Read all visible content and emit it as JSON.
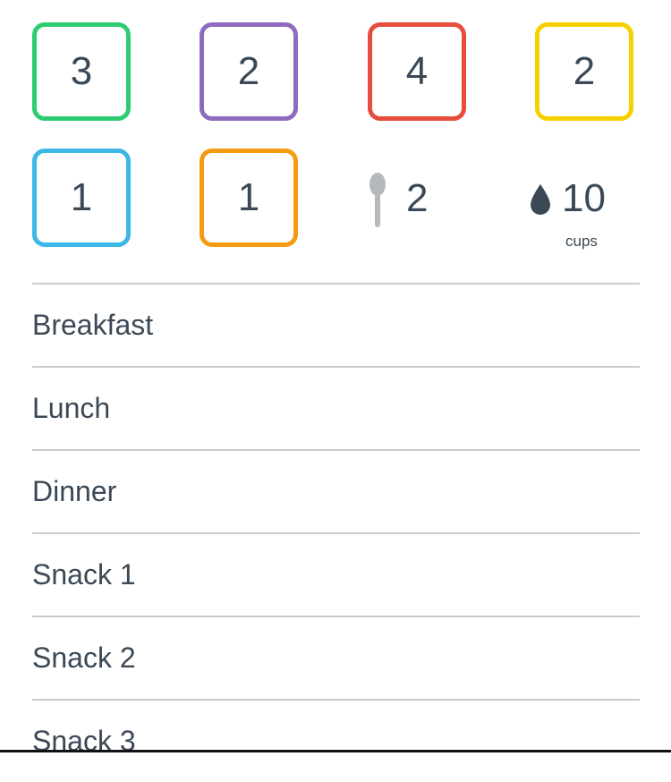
{
  "portion_boxes": [
    {
      "count": "3",
      "color": "#2ecc71"
    },
    {
      "count": "2",
      "color": "#8e6bbf"
    },
    {
      "count": "4",
      "color": "#e74c3c"
    },
    {
      "count": "2",
      "color": "#f7d000"
    },
    {
      "count": "1",
      "color": "#3bb8e6"
    },
    {
      "count": "1",
      "color": "#f39c12"
    }
  ],
  "teaspoons": {
    "count": "2",
    "icon": "spoon-icon",
    "color": "#b5b9bc"
  },
  "water": {
    "count": "10",
    "unit": "cups",
    "icon": "water-drop-icon",
    "color": "#3b4856"
  },
  "meals": [
    "Breakfast",
    "Lunch",
    "Dinner",
    "Snack 1",
    "Snack 2",
    "Snack 3"
  ],
  "divider_color": "#c8cccf"
}
